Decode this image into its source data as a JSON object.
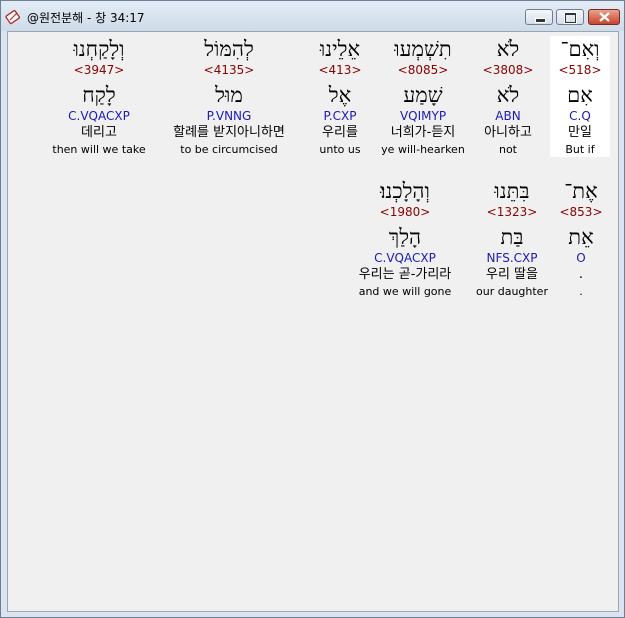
{
  "window": {
    "title": "@원전분해 - 창 34:17",
    "icon": "bible-app-icon",
    "buttons": [
      "minimize",
      "maximize",
      "close"
    ]
  },
  "colors": {
    "strong_number": "#8b0000",
    "morphology": "#1a1ab8",
    "selected_background": "#ffffff"
  },
  "rows": [
    {
      "words": [
        {
          "hebrew": "וְאִם־",
          "strong": "<518>",
          "lexeme": "אִם",
          "morph": "C.Q",
          "korean": "만일",
          "english": "But if",
          "selected": true
        },
        {
          "hebrew": "לֹא",
          "strong": "<3808>",
          "lexeme": "לֹא",
          "morph": "ABN",
          "korean": "아니하고",
          "english": "not"
        },
        {
          "hebrew": "תִשְׁמְעוּ",
          "strong": "<8085>",
          "lexeme": "שָׁמַע",
          "morph": "VQIMYP",
          "korean": "너희가-듣지",
          "english": "ye will-hearken"
        },
        {
          "hebrew": "אֵלֵינוּ",
          "strong": "<413>",
          "lexeme": "אֶל",
          "morph": "P.CXP",
          "korean": "우리를",
          "english": "unto us"
        },
        {
          "hebrew": "לְהִמּוֹל",
          "strong": "<4135>",
          "lexeme": "מוּל",
          "morph": "P.VNNG",
          "korean": "할례를 받지아니하면",
          "english": "to be circumcised"
        },
        {
          "hebrew": "וְלָקַחְנוּ",
          "strong": "<3947>",
          "lexeme": "לָקַח",
          "morph": "C.VQACXP",
          "korean": "데리고",
          "english": "then will we take"
        }
      ]
    },
    {
      "words": [
        {
          "hebrew": "אֶת־",
          "strong": "<853>",
          "lexeme": "אֵת",
          "morph": "O",
          "korean": ".",
          "english": "."
        },
        {
          "hebrew": "בִּתֵּנוּ",
          "strong": "<1323>",
          "lexeme": "בַּת",
          "morph": "NFS.CXP",
          "korean": "우리 딸을",
          "english": "our daughter"
        },
        {
          "hebrew": "וְהָלָכְנוּ׃",
          "strong": "<1980>",
          "lexeme": "הָלַךְ",
          "morph": "C.VQACXP",
          "korean": "우리는 곧-가리라",
          "english": "and we will gone"
        }
      ]
    }
  ]
}
